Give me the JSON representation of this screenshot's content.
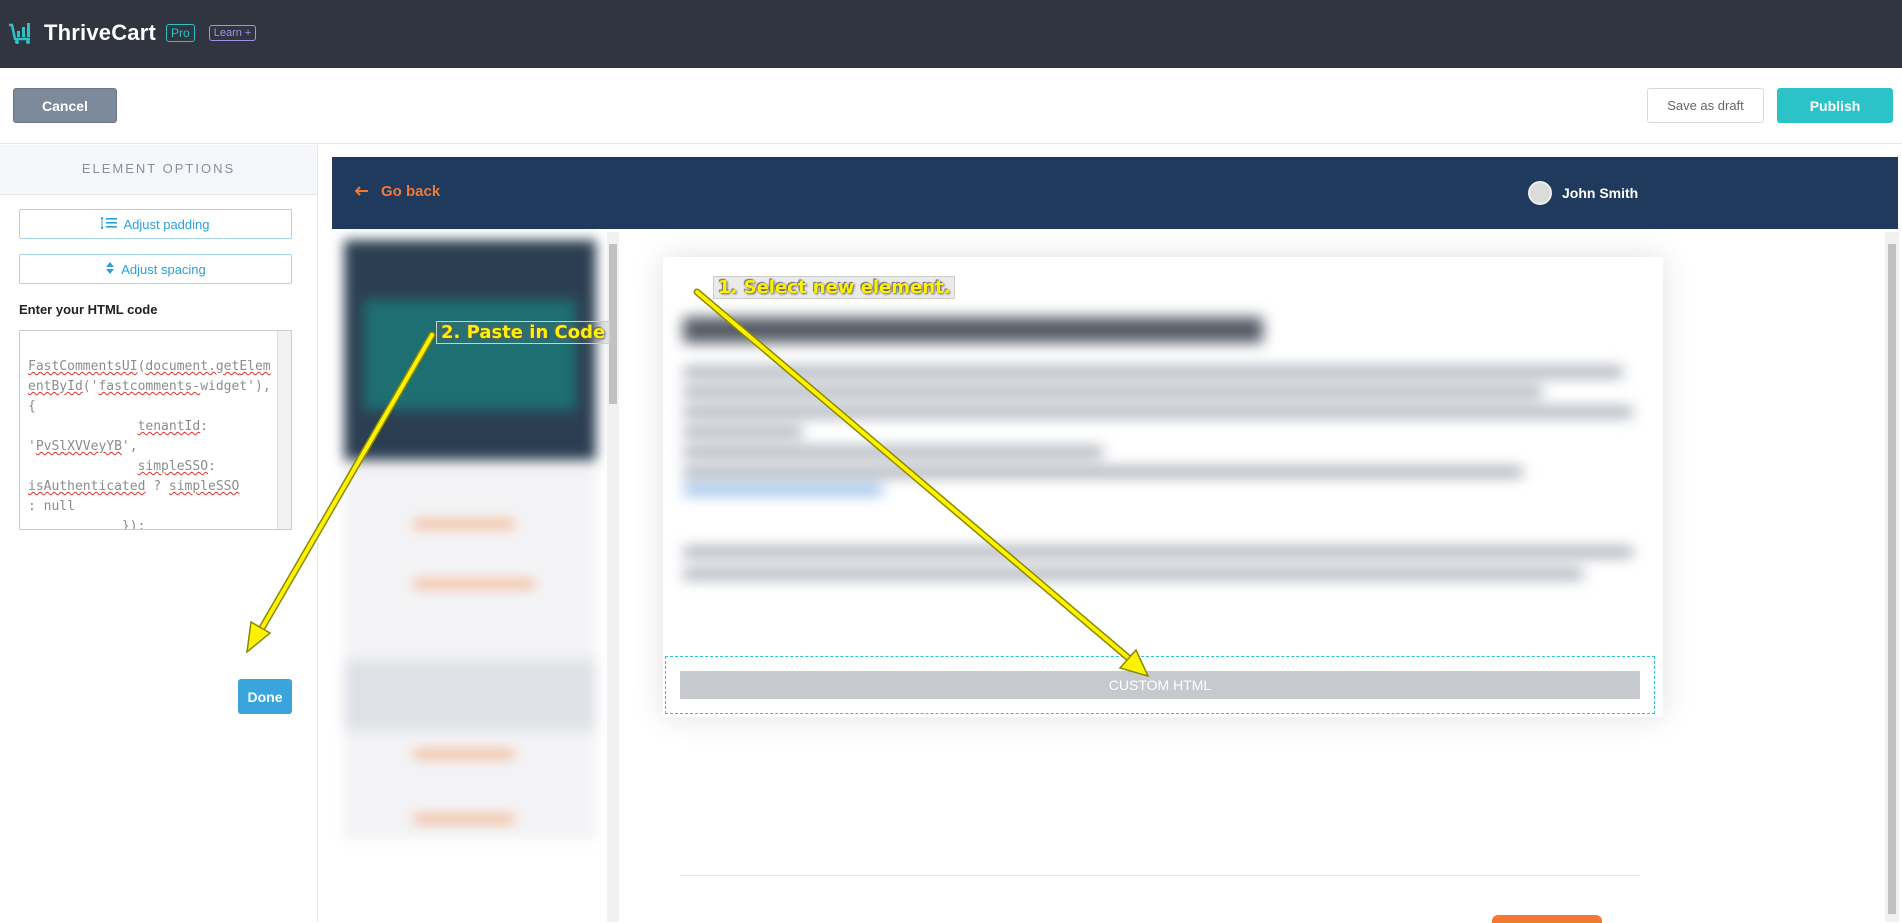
{
  "app": {
    "logo_text": "ThriveCart",
    "badge_pro": "Pro",
    "badge_learn": "Learn +"
  },
  "toolbar": {
    "cancel_label": "Cancel",
    "save_draft_label": "Save as draft",
    "publish_label": "Publish"
  },
  "element_options": {
    "title": "ELEMENT OPTIONS",
    "adjust_padding_label": "Adjust padding",
    "adjust_spacing_label": "Adjust spacing",
    "html_label": "Enter your HTML code",
    "done_label": "Done"
  },
  "preview": {
    "go_back_label": "Go back",
    "user_name": "John Smith",
    "custom_html_label": "CUSTOM HTML"
  },
  "annotations": {
    "step1": "1. Select new element.",
    "step2": "2. Paste in Code"
  },
  "colors": {
    "accent": "#2bc3c8",
    "header_bg": "#30353f",
    "preview_header_bg": "#1f3a5c",
    "orange": "#f27935",
    "annotation_yellow": "#fff200"
  }
}
